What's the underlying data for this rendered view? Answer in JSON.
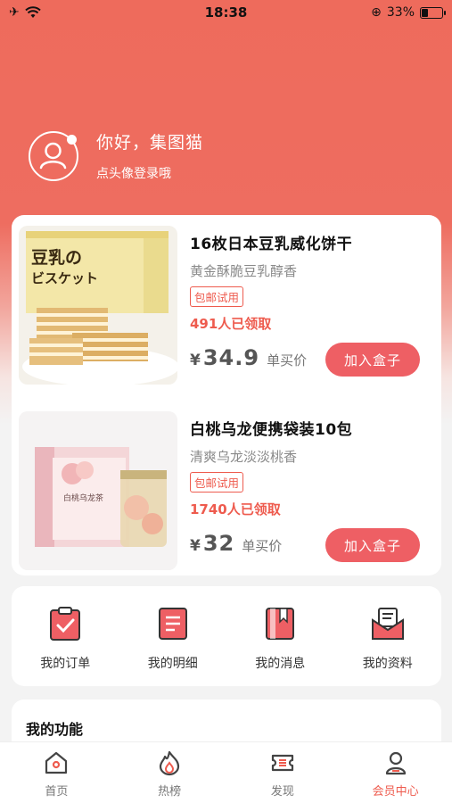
{
  "status_bar": {
    "time": "18:38",
    "battery_text": "33%",
    "battery_level": 0.33
  },
  "profile": {
    "greeting": "你好，集图猫",
    "login_hint": "点头像登录哦"
  },
  "products": [
    {
      "title": "16枚日本豆乳威化饼干",
      "subtitle": "黄金酥脆豆乳醇香",
      "tag": "包邮试用",
      "claimed": "491人已领取",
      "currency": "¥",
      "price": "34.9",
      "price_label": "单买价",
      "button": "加入盒子",
      "image_box_text": "豆乳の\nビスケット"
    },
    {
      "title": "白桃乌龙便携袋装10包",
      "subtitle": "清爽乌龙淡淡桃香",
      "tag": "包邮试用",
      "claimed": "1740人已领取",
      "currency": "¥",
      "price": "32",
      "price_label": "单买价",
      "button": "加入盒子",
      "image_box_text": "白桃乌龙茶"
    }
  ],
  "quick_actions": [
    {
      "label": "我的订单",
      "icon": "clipboard-check-icon"
    },
    {
      "label": "我的明细",
      "icon": "document-list-icon"
    },
    {
      "label": "我的消息",
      "icon": "bookmark-book-icon"
    },
    {
      "label": "我的资料",
      "icon": "mail-profile-icon"
    }
  ],
  "functions": {
    "title": "我的功能"
  },
  "bottom_nav": [
    {
      "label": "首页",
      "icon": "home-icon"
    },
    {
      "label": "热榜",
      "icon": "flame-icon"
    },
    {
      "label": "发现",
      "icon": "ticket-icon"
    },
    {
      "label": "会员中心",
      "icon": "user-icon",
      "active": true
    }
  ],
  "colors": {
    "accent": "#ee5b4e",
    "header": "#ee6b5c",
    "button": "#ee5f64"
  }
}
